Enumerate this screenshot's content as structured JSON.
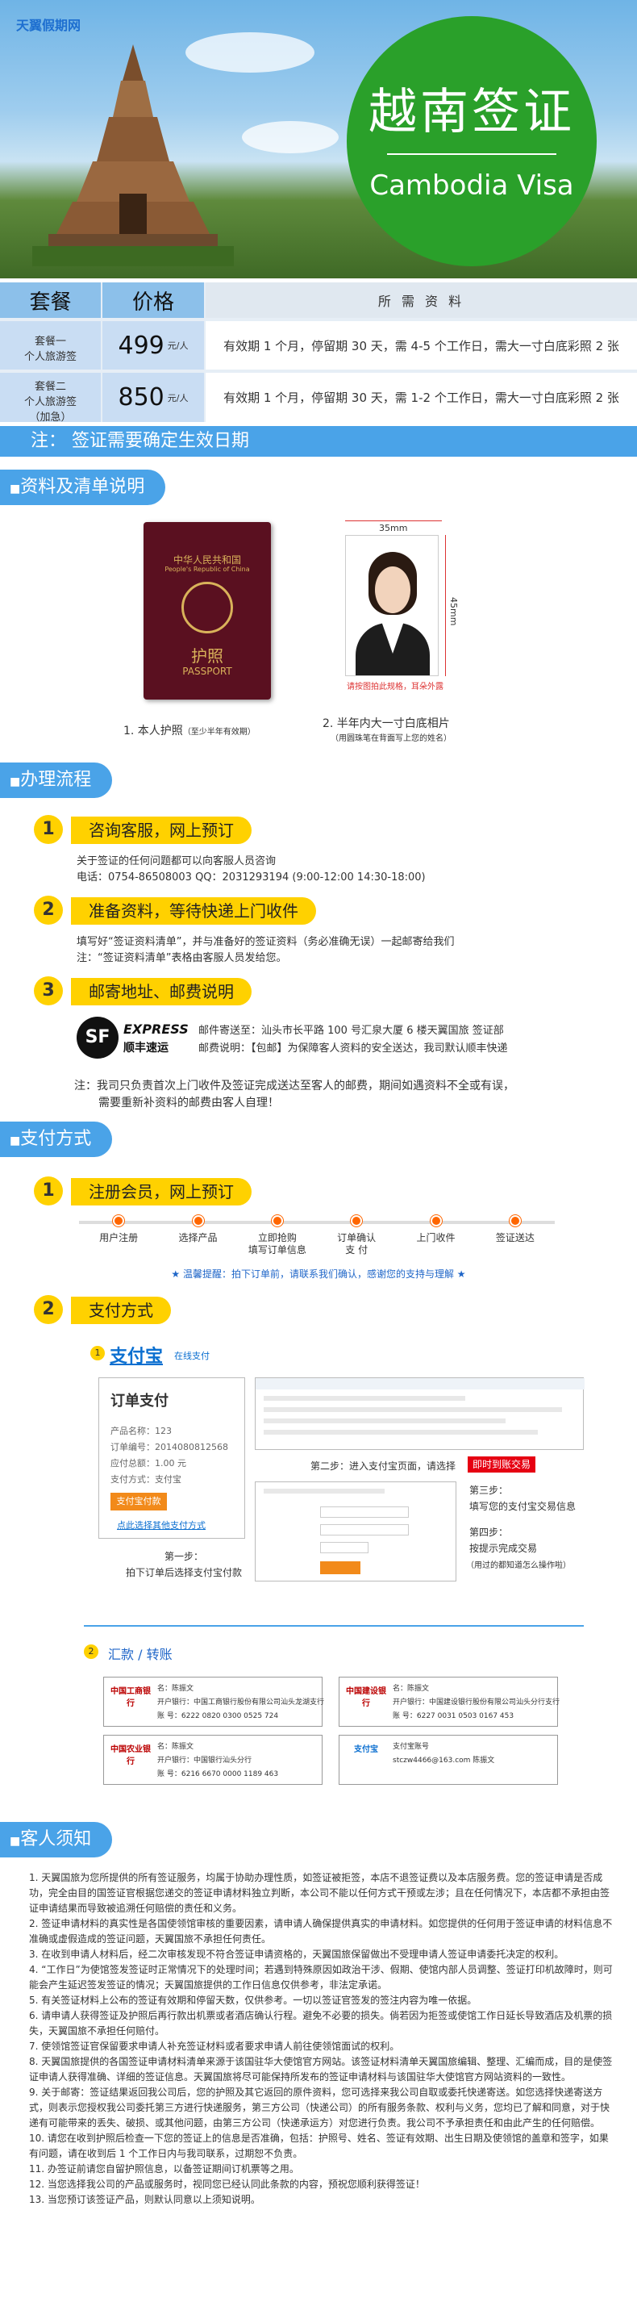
{
  "header": {
    "logo": "天翼假期网",
    "title_cn": "越南签证",
    "title_en": "Cambodia Visa"
  },
  "price_table": {
    "col_package": "套餐",
    "col_price": "价格",
    "col_docs": "所 需 资 料",
    "rows": [
      {
        "name": "套餐一",
        "sub": "个人旅游签",
        "price": "499",
        "unit": "元/人",
        "desc": "有效期 1 个月，停留期 30 天，需 4-5 个工作日，需大一寸白底彩照 2 张"
      },
      {
        "name": "套餐二",
        "sub": "个人旅游签",
        "sub2": "（加急）",
        "price": "850",
        "unit": "元/人",
        "desc": "有效期 1 个月，停留期 30 天，需 1-2 个工作日，需大一寸白底彩照 2 张"
      }
    ],
    "note": "注：  签证需要确定生效日期"
  },
  "sections": {
    "materials": "资料及清单说明",
    "process": "办理流程",
    "payment": "支付方式",
    "notice": "客人须知"
  },
  "materials": {
    "passport_cover_cn": "中华人民共和国",
    "passport_cover_cn2": "People's Republic of China",
    "passport_word": "护照",
    "passport_en": "PASSPORT",
    "photo_width": "35mm",
    "photo_height": "45mm",
    "photo_caption": "请按图拍此规格，耳朵外露",
    "item1": "1. 本人护照",
    "item1_note": "（至少半年有效期）",
    "item2": "2. 半年内大一寸白底相片",
    "item2_note": "（用圆珠笔在背面写上您的姓名）"
  },
  "process": {
    "step1_title": "咨询客服，网上预订",
    "step1_line1": "关于签证的任何问题都可以向客服人员咨询",
    "step1_line2": "电话：0754-86508003    QQ：2031293194  (9:00-12:00  14:30-18:00)",
    "step2_title": "准备资料，等待快递上门收件",
    "step2_line1": "填写好“签证资料清单”，并与准备好的签证资料（务必准确无误）一起邮寄给我们",
    "step2_line2": "注：“签证资料清单”表格由客服人员发给您。",
    "step3_title": "邮寄地址、邮费说明",
    "sf_logo": "SF",
    "sf_express": "EXPRESS",
    "sf_cn": "顺丰速运",
    "step3_line1": "邮件寄送至：汕头市长平路 100 号汇泉大厦 6 楼天翼国旅 签证部",
    "step3_line2": "邮费说明：【包邮】为保障客人资料的安全送达，我司默认顺丰快递",
    "footnote1": "注：我司只负责首次上门收件及签证完成送达至客人的邮费，期间如遇资料不全或有误，",
    "footnote2": "需要重新补资料的邮费由客人自理！"
  },
  "payment": {
    "step1_title": "注册会员，网上预订",
    "flow": [
      "用户注册",
      "选择产品",
      "立即抢购\n填写订单信息",
      "订单确认\n支 付",
      "上门收件",
      "签证送达"
    ],
    "flow_tip": "★ 温馨提醒：拍下订单前，请联系我们确认，感谢您的支持与理解 ★",
    "step2_title": "支付方式",
    "alipay_num": "1",
    "alipay_logo": "支付宝",
    "alipay_online": "在线支付",
    "order_title": "订单支付",
    "order_lines": [
      "产品名称：123",
      "订单编号：2014080812568",
      "应付总额：1.00 元",
      "支付方式：支付宝"
    ],
    "order_btn": "支付宝付款",
    "order_link": "点此选择其他支付方式",
    "step_a_label": "第一步：",
    "step_a_desc": "拍下订单后选择支付宝付款",
    "step_b_label": "第二步：进入支付宝页面，请选择",
    "step_b_btn": "即时到账交易",
    "step_c_label": "第三步：",
    "step_c_desc": "填写您的支付宝交易信息",
    "step_d_label": "第四步：",
    "step_d_desc": "按提示完成交易",
    "step_d_note": "（用过的都知道怎么操作啦）",
    "transfer_num": "2",
    "transfer_title": "汇款 / 转账",
    "banks": [
      {
        "bank": "中国工商银行",
        "name": "名：陈振文",
        "branch": "开户银行：中国工商银行股份有限公司汕头龙湖支行",
        "acct": "账  号：6222 0820 0300 0525 724"
      },
      {
        "bank": "中国建设银行",
        "name": "名：陈振文",
        "branch": "开户银行：中国建设银行股份有限公司汕头分行支行",
        "acct": "账  号：6227 0031 0503 0167 453"
      },
      {
        "bank": "中国农业银行",
        "name": "名：陈振文",
        "branch": "开户银行：中国银行汕头分行",
        "acct": "账  号：6216 6670 0000 1189 463"
      },
      {
        "bank": "支付宝",
        "name": "支付宝账号",
        "branch": "stczw4466@163.com  陈振文",
        "acct": ""
      }
    ]
  },
  "notice": [
    "1. 天翼国旅为您所提供的所有签证服务，均属于协助办理性质，如签证被拒签，本店不退签证费以及本店服务费。您的签证申请是否成功，完全由目的国签证官根据您递交的签证申请材料独立判断，本公司不能以任何方式干预或左涉；且在任何情况下，本店都不承担由签证申请结果而导致被追溯任何赔偿的责任和义务。",
    "2. 签证申请材料的真实性是各国使领馆审核的重要因素，请申请人确保提供真实的申请材料。如您提供的任何用于签证申请的材料信息不准确或虚假造成的签证问题，天翼国旅不承担任何责任。",
    "3. 在收到申请人材料后，经二次审核发现不符合签证申请资格的，天翼国旅保留做出不受理申请人签证申请委托决定的权利。",
    "4. “工作日”为使馆签发签证时正常情况下的处理时间；若遇到特殊原因如政治干涉、假期、使馆内部人员调整、签证打印机故障时，则可能会产生延迟签发签证的情况；天翼国旅提供的工作日信息仅供参考，非法定承诺。",
    "5. 有关签证材料上公布的签证有效期和停留天数，仅供参考。一切以签证官签发的签注内容为唯一依据。",
    "6. 请申请人获得签证及护照后再行款出机票或者酒店确认行程。避免不必要的损失。倘若因为拒签或使馆工作日延长导致酒店及机票的损失，天翼国旅不承担任何赔付。",
    "7. 使领馆签证官保留要求申请人补充签证材料或者要求申请人前往使领馆面试的权利。",
    "8. 天翼国旅提供的各国签证申请材料清单来源于该国驻华大使馆官方网站。该签证材料清单天翼国旅编辑、整理、汇编而成，目的是使签证申请人获得准确、详细的签证信息。天翼国旅将尽可能保持所发布的签证申请材料与该国驻华大使馆官方网站资料的一致性。",
    "9. 关于邮寄：签证结果返回我公司后，您的护照及其它返回的原件资料，您可选择来我公司自取或委托快递寄送。如您选择快递寄送方式，则表示您授权我公司委托第三方进行快递服务，第三方公司（快递公司）的所有服务条款、权利与义务，您均已了解和同意，对于快递有可能带来的丢失、破损、或其他问题，由第三方公司（快递承运方）对您进行负责。我公司不予承担责任和由此产生的任何赔偿。",
    "10. 请您在收到护照后检查一下您的签证上的信息是否准确，包括：护照号、姓名、签证有效期、出生日期及使领馆的盖章和签字，如果有问题，请在收到后 1 个工作日内与我司联系，过期恕不负责。",
    "11. 办签证前请您自留护照信息，以备签证期间订机票等之用。",
    "12. 当您选择我公司的产品或服务时，视同您已经认同此条款的内容，预祝您顺利获得签证！",
    "13. 当您预订该签证产品，则默认同意以上须知说明。"
  ],
  "colors": {
    "accent_blue": "#4aa3e8",
    "yellow": "#ffd100",
    "green": "#2aa02a"
  }
}
